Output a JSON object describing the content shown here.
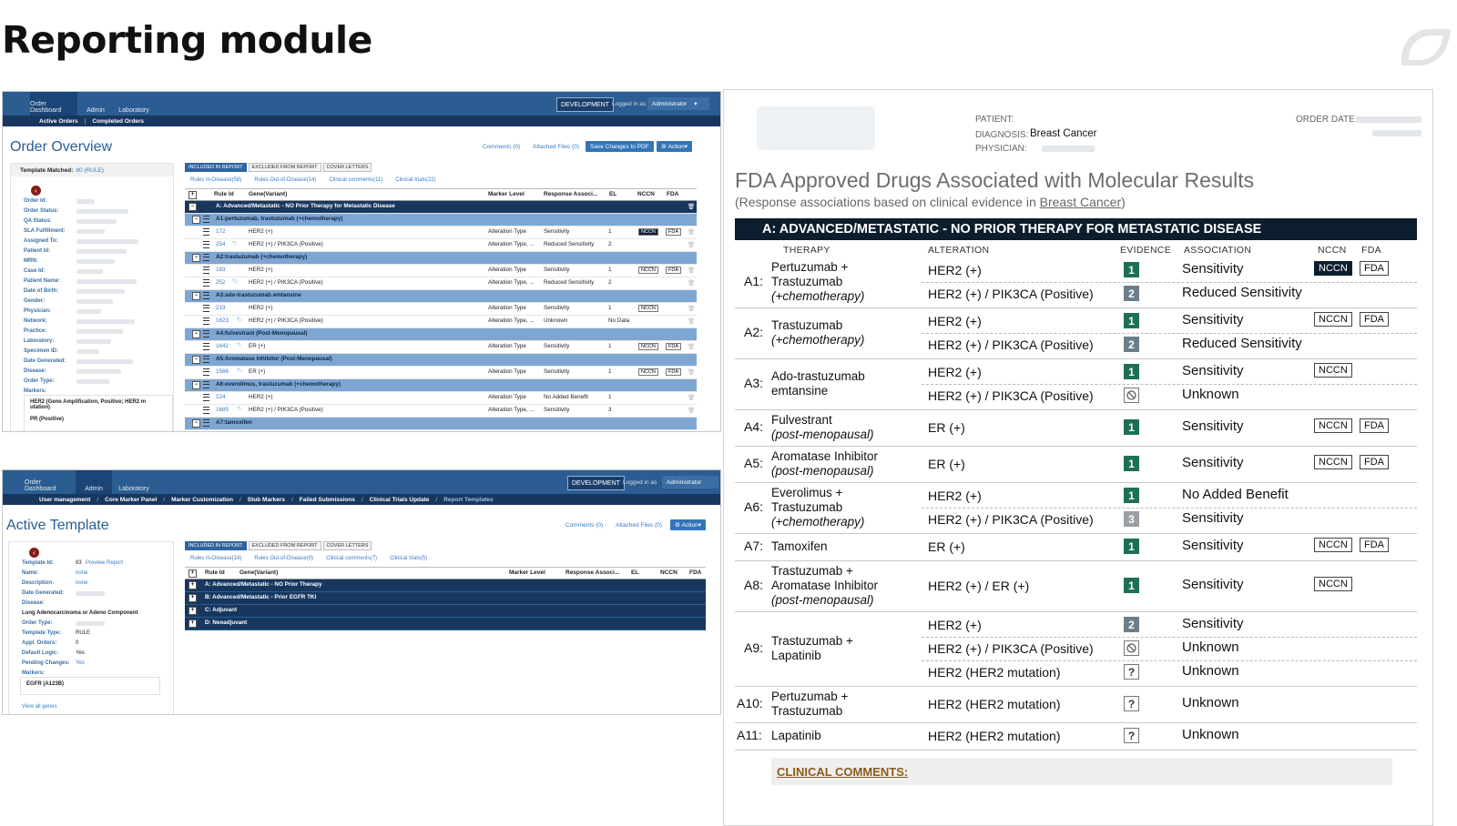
{
  "page_title": "Reporting module",
  "colors": {
    "nav_blue": "#2c5d92",
    "nav_dark": "#17375f",
    "band_dark": "#0c1d2d",
    "evidence_green": "#1f6f57",
    "evidence_gray": "#6c7f89",
    "comments_brown": "#8b5a1c"
  },
  "order_panel": {
    "nav": [
      "Order Dashboard",
      "Admin",
      "Laboratory"
    ],
    "dev_badge": "DEVELOPMENT",
    "logged_in": "Logged in as",
    "user": "Administrator",
    "subnav": [
      "Active Orders",
      "Completed Orders"
    ],
    "title": "Order Overview",
    "comments_link": "Comments (0)",
    "files_link": "Attached Files (0)",
    "save_btn": "Save Changes to PDF",
    "action_btn": "Action",
    "template_matched_label": "Template Matched:",
    "template_matched_value": "80 (RULE)",
    "fields": [
      "Order Id:",
      "Order Status:",
      "QA Status:",
      "SLA Fulfillment:",
      "Assigned To:",
      "Patient Id:",
      "MRN:",
      "Case Id:",
      "Patient Name:",
      "Date of Birth:",
      "Gender:",
      "Physician:",
      "Network:",
      "Practice:",
      "Laboratory:",
      "Specimen ID:",
      "Date Generated:",
      "Disease:",
      "Order Type:",
      "Markers:"
    ],
    "markers": [
      "HER2 (Gene Amplification, Positive; HER2 m utation)",
      "PR (Positive)"
    ],
    "tabs": [
      "INCLUDED IN REPORT",
      "EXCLUDED FROM REPORT",
      "COVER LETTERS"
    ],
    "rule_links": [
      "Rules In-Disease(58)",
      "Rules Out-of-Disease(14)",
      "Clinical comments(11)",
      "Clinical trials(22)"
    ],
    "columns": [
      "Rule Id",
      "Gene(Variant)",
      "Marker Level",
      "Response Associ...",
      "EL",
      "NCCN",
      "FDA"
    ],
    "section": "A:  Advanced/Metastatic - NO Prior Therapy for Metastatic Disease",
    "groups": [
      {
        "label": "A1:pertuzumab, trastuzumab (+chemotherapy)",
        "rows": [
          {
            "id": "172",
            "gene": "HER2 (+)",
            "level": "Alteration Type",
            "resp": "Sensitivity",
            "el": "1",
            "nccn": "NCCN",
            "nccn_dark": true,
            "fda": "FDA"
          },
          {
            "id": "254",
            "gene": "HER2 (+) / PIK3CA (Positive)",
            "level": "Alteration Type, ...",
            "resp": "Reduced Sensitivity",
            "el": "2",
            "nccn": "",
            "fda": ""
          }
        ]
      },
      {
        "label": "A2:trastuzumab (+chemotherapy)",
        "rows": [
          {
            "id": "183",
            "gene": "HER2 (+)",
            "level": "Alteration Type",
            "resp": "Sensitivity",
            "el": "1",
            "nccn": "NCCN",
            "fda": "FDA"
          },
          {
            "id": "252",
            "gene": "HER2 (+) / PIK3CA (Positive)",
            "level": "Alteration Type, ...",
            "resp": "Reduced Sensitivity",
            "el": "2",
            "nccn": "",
            "fda": ""
          }
        ]
      },
      {
        "label": "A3:ado-trastuzumab emtansine",
        "rows": [
          {
            "id": "219",
            "gene": "HER2 (+)",
            "level": "Alteration Type",
            "resp": "Sensitivity",
            "el": "1",
            "nccn": "NCCN",
            "fda": ""
          },
          {
            "id": "1623",
            "gene": "HER2 (+) / PIK3CA (Positive)",
            "level": "Alteration Type, ...",
            "resp": "Unknown",
            "el": "No Data",
            "nccn": "",
            "fda": ""
          }
        ]
      },
      {
        "label": "A4:fulvestrant (Post-Menopausal)",
        "rows": [
          {
            "id": "1642",
            "gene": "ER (+)",
            "level": "Alteration Type",
            "resp": "Sensitivity",
            "el": "1",
            "nccn": "NCCN",
            "fda": "FDA"
          }
        ]
      },
      {
        "label": "A5:Aromatase Inhibitor (Post-Menopausal)",
        "rows": [
          {
            "id": "1566",
            "gene": "ER (+)",
            "level": "Alteration Type",
            "resp": "Sensitivity",
            "el": "1",
            "nccn": "NCCN",
            "fda": "FDA"
          }
        ]
      },
      {
        "label": "A6:everolimus, trastuzumab (+chemotherapy)",
        "rows": [
          {
            "id": "224",
            "gene": "HER2 (+)",
            "level": "Alteration Type",
            "resp": "No Added Benefit",
            "el": "1",
            "nccn": "",
            "fda": ""
          },
          {
            "id": "1685",
            "gene": "HER2 (+) / PIK3CA (Positive)",
            "level": "Alteration Type, ...",
            "resp": "Sensitivity",
            "el": "3",
            "nccn": "",
            "fda": ""
          }
        ]
      },
      {
        "label": "A7:tamoxifen",
        "rows": [
          {
            "id": "1646",
            "gene": "ER (+)",
            "level": "Alteration Type",
            "resp": "Sensitivity",
            "el": "1",
            "nccn": "NCCN",
            "fda": "FDA"
          }
        ]
      }
    ]
  },
  "template_panel": {
    "nav": [
      "Order Dashboard",
      "Admin",
      "Laboratory"
    ],
    "dev_badge": "DEVELOPMENT",
    "logged_in": "Logged in as",
    "user": "Administrator",
    "subnav": [
      "User management",
      "Core Marker Panel",
      "Marker Customization",
      "Stub Markers",
      "Failed Submissions",
      "Clinical Trials Update",
      "Report Templates"
    ],
    "title": "Active Template",
    "comments_link": "Comments (0)",
    "files_link": "Attached Files (0)",
    "action_btn": "Action",
    "fields": [
      {
        "label": "Template Id:",
        "value": "83",
        "link": "Preview Report"
      },
      {
        "label": "Name:",
        "value": "none"
      },
      {
        "label": "Description:",
        "value": "none"
      },
      {
        "label": "Date Generated:",
        "value": ""
      },
      {
        "label": "Disease:",
        "value": "Lung Adenocarcinoma or Adeno Component"
      },
      {
        "label": "Order Type:",
        "value": ""
      },
      {
        "label": "Template Type:",
        "value": "RULE"
      },
      {
        "label": "Appl. Orders:",
        "value": "0"
      },
      {
        "label": "Default Logic:",
        "value": "Yes"
      },
      {
        "label": "Pending Changes:",
        "value": "Yes"
      },
      {
        "label": "Markers:",
        "value": ""
      }
    ],
    "marker": "EGFR (A123B)",
    "view_all": "View all genes",
    "tabs": [
      "INCLUDED IN REPORT",
      "EXCLUDED FROM REPORT",
      "COVER LETTERS"
    ],
    "rule_links": [
      "Rules In-Disease(14)",
      "Rules Out-of-Disease(0)",
      "Clinical comments(7)",
      "Clinical trials(5)"
    ],
    "columns": [
      "Rule Id",
      "Gene(Variant)",
      "Marker Level",
      "Response Associ...",
      "EL",
      "NCCN",
      "FDA"
    ],
    "sections": [
      "A:  Advanced/Metastatic - NO Prior Therapy",
      "B:  Advanced/Metastatic - Prior EGFR TKI",
      "C:  Adjuvant",
      "D:  Neoadjuvant"
    ]
  },
  "report": {
    "patient_label": "PATIENT:",
    "diagnosis_label": "DIAGNOSIS:",
    "diagnosis_value": "Breast Cancer",
    "physician_label": "PHYSICIAN:",
    "order_date_label": "ORDER DATE:",
    "title": "FDA Approved Drugs Associated with Molecular Results",
    "subtitle_prefix": "(Response associations based on clinical evidence in ",
    "subtitle_link": "Breast Cancer",
    "subtitle_suffix": ")",
    "band": "A:  ADVANCED/METASTATIC - NO PRIOR THERAPY FOR METASTATIC DISEASE",
    "columns": [
      "THERAPY",
      "ALTERATION",
      "EVIDENCE",
      "ASSOCIATION",
      "NCCN",
      "FDA"
    ],
    "rows": [
      {
        "label": "A1:",
        "therapy": [
          "Pertuzumab +",
          "Trastuzumab"
        ],
        "therapy_italic": "(+chemotherapy)",
        "nccn": "NCCN",
        "nccn_dark": true,
        "fda": "FDA",
        "lines": [
          {
            "alt": "HER2 (+)",
            "ev": "1",
            "assoc": "Sensitivity"
          },
          {
            "alt": "HER2 (+) / PIK3CA (Positive)",
            "ev": "2",
            "assoc": "Reduced Sensitivity"
          }
        ]
      },
      {
        "label": "A2:",
        "therapy": [
          "Trastuzumab"
        ],
        "therapy_italic": "(+chemotherapy)",
        "nccn": "NCCN",
        "fda": "FDA",
        "lines": [
          {
            "alt": "HER2 (+)",
            "ev": "1",
            "assoc": "Sensitivity"
          },
          {
            "alt": "HER2 (+) / PIK3CA (Positive)",
            "ev": "2",
            "assoc": "Reduced Sensitivity"
          }
        ]
      },
      {
        "label": "A3:",
        "therapy": [
          "Ado-trastuzumab",
          "emtansine"
        ],
        "therapy_italic": "",
        "nccn": "NCCN",
        "fda": "",
        "lines": [
          {
            "alt": "HER2 (+)",
            "ev": "1",
            "assoc": "Sensitivity"
          },
          {
            "alt": "HER2 (+) / PIK3CA (Positive)",
            "ev": "none",
            "assoc": "Unknown"
          }
        ]
      },
      {
        "label": "A4:",
        "therapy": [
          "Fulvestrant"
        ],
        "therapy_italic": "(post-menopausal)",
        "nccn": "NCCN",
        "fda": "FDA",
        "lines": [
          {
            "alt": "ER (+)",
            "ev": "1",
            "assoc": "Sensitivity"
          }
        ]
      },
      {
        "label": "A5:",
        "therapy": [
          "Aromatase Inhibitor"
        ],
        "therapy_italic": "(post-menopausal)",
        "nccn": "NCCN",
        "fda": "FDA",
        "lines": [
          {
            "alt": "ER (+)",
            "ev": "1",
            "assoc": "Sensitivity"
          }
        ]
      },
      {
        "label": "A6:",
        "therapy": [
          "Everolimus +",
          "Trastuzumab"
        ],
        "therapy_italic": "(+chemotherapy)",
        "nccn": "",
        "fda": "",
        "lines": [
          {
            "alt": "HER2 (+)",
            "ev": "1",
            "assoc": "No Added Benefit"
          },
          {
            "alt": "HER2 (+) / PIK3CA (Positive)",
            "ev": "3",
            "assoc": "Sensitivity"
          }
        ]
      },
      {
        "label": "A7:",
        "therapy": [
          "Tamoxifen"
        ],
        "therapy_italic": "",
        "nccn": "NCCN",
        "fda": "FDA",
        "lines": [
          {
            "alt": "ER (+)",
            "ev": "1",
            "assoc": "Sensitivity"
          }
        ]
      },
      {
        "label": "A8:",
        "therapy": [
          "Trastuzumab +",
          "Aromatase Inhibitor"
        ],
        "therapy_italic": "(post-menopausal)",
        "nccn": "NCCN",
        "fda": "",
        "lines": [
          {
            "alt": "HER2 (+) / ER (+)",
            "ev": "1",
            "assoc": "Sensitivity"
          }
        ]
      },
      {
        "label": "A9:",
        "therapy": [
          "Trastuzumab +",
          "Lapatinib"
        ],
        "therapy_italic": "",
        "nccn": "",
        "fda": "",
        "lines": [
          {
            "alt": "HER2 (+)",
            "ev": "2",
            "assoc": "Sensitivity"
          },
          {
            "alt": "HER2 (+) / PIK3CA (Positive)",
            "ev": "none",
            "assoc": "Unknown"
          },
          {
            "alt": "HER2 (HER2 mutation)",
            "ev": "?",
            "assoc": "Unknown"
          }
        ]
      },
      {
        "label": "A10:",
        "therapy": [
          "Pertuzumab +",
          "Trastuzumab"
        ],
        "therapy_italic": "",
        "nccn": "",
        "fda": "",
        "lines": [
          {
            "alt": "HER2 (HER2 mutation)",
            "ev": "?",
            "assoc": "Unknown"
          }
        ]
      },
      {
        "label": "A11:",
        "therapy": [
          "Lapatinib"
        ],
        "therapy_italic": "",
        "nccn": "",
        "fda": "",
        "lines": [
          {
            "alt": "HER2 (HER2 mutation)",
            "ev": "?",
            "assoc": "Unknown"
          }
        ]
      }
    ],
    "clinical_comments": "CLINICAL COMMENTS:"
  }
}
